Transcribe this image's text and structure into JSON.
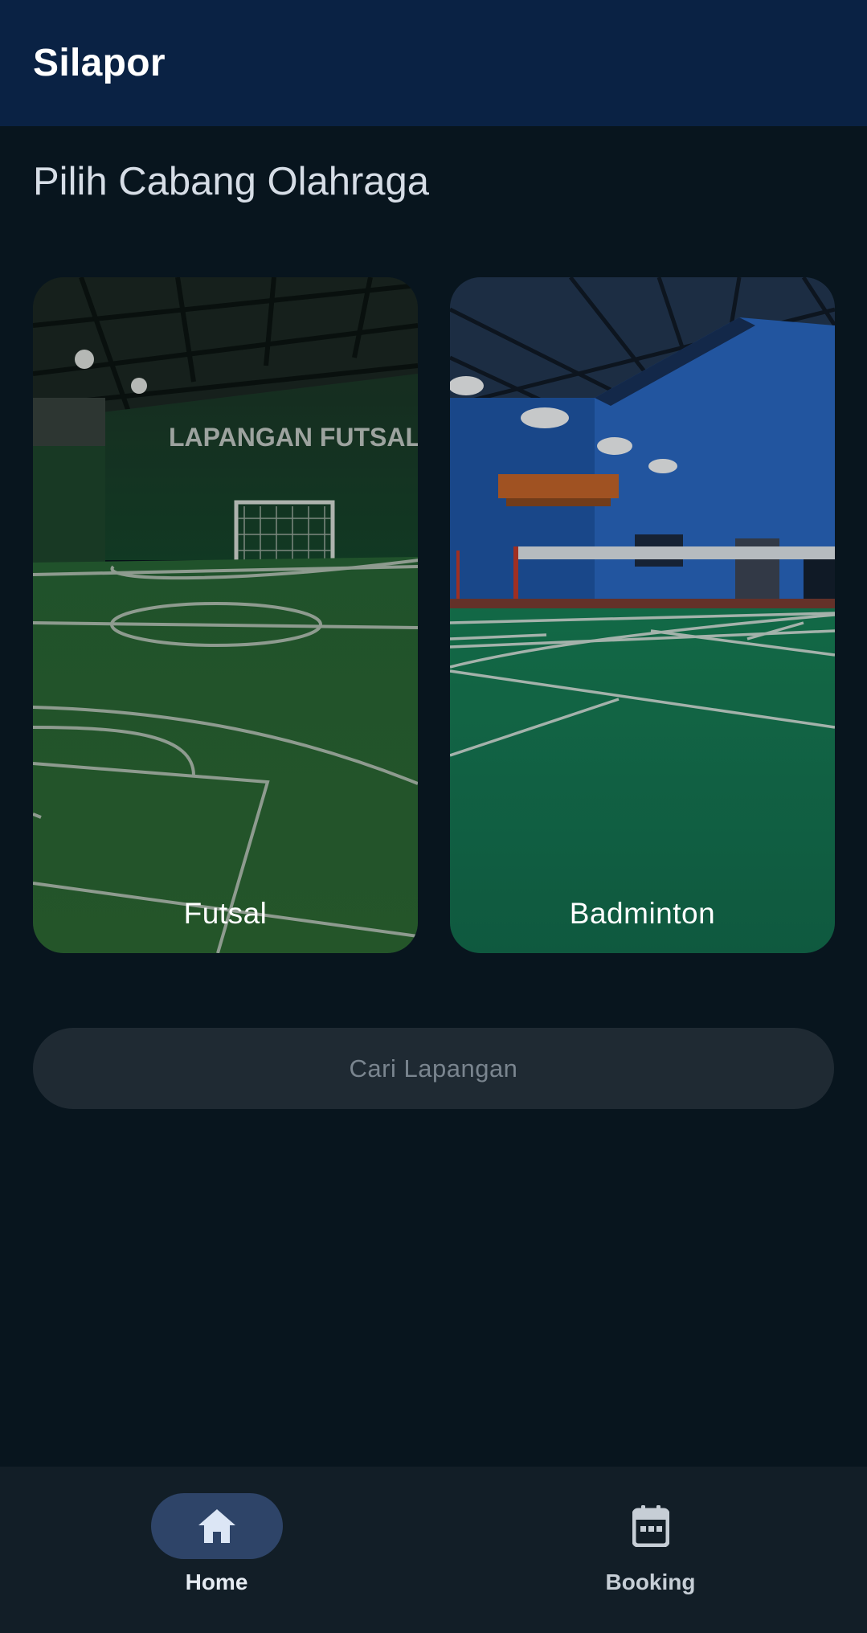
{
  "app_bar": {
    "title": "Silapor",
    "color": "#0a2244"
  },
  "section": {
    "title": "Pilih Cabang Olahraga"
  },
  "sports": [
    {
      "label": "Futsal",
      "wall_text": "LAPANGAN FUTSAL",
      "image": "futsal-court-photo"
    },
    {
      "label": "Badminton",
      "image": "badminton-court-photo"
    }
  ],
  "search": {
    "label": "Cari Lapangan"
  },
  "bottom_nav": {
    "items": [
      {
        "label": "Home",
        "icon": "home-icon",
        "selected": true
      },
      {
        "label": "Booking",
        "icon": "calendar-icon",
        "selected": false
      }
    ]
  }
}
